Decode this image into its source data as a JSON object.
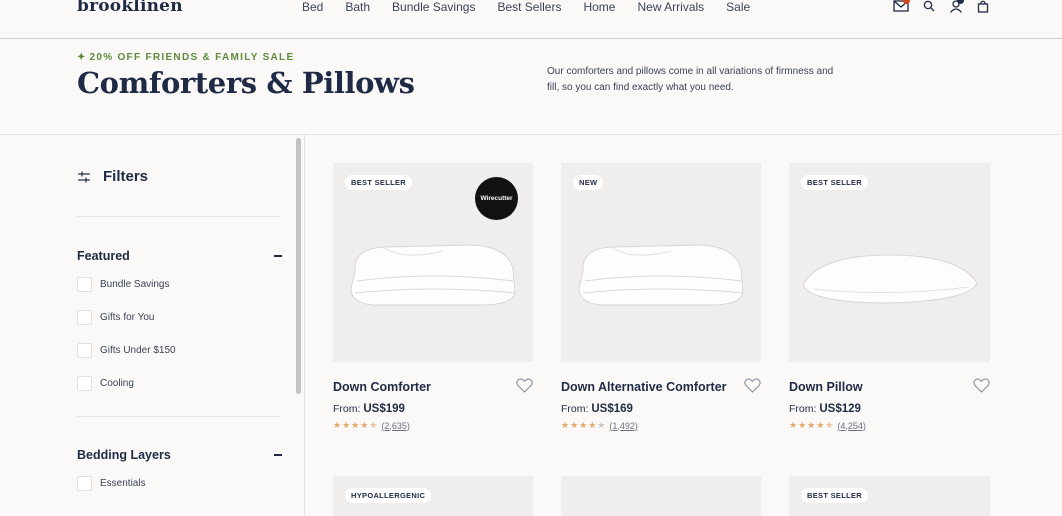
{
  "brand": "brooklinen",
  "nav": [
    "Bed",
    "Bath",
    "Bundle Savings",
    "Best Sellers",
    "Home",
    "New Arrivals",
    "Sale"
  ],
  "header_icons": [
    "mail-icon",
    "search-icon",
    "account-icon",
    "bag-icon"
  ],
  "hero": {
    "promo": "20% OFF FRIENDS & FAMILY SALE",
    "title": "Comforters & Pillows",
    "subtitle": "Our comforters and pillows come in all variations of firmness and fill, so you can find exactly what you need."
  },
  "filters": {
    "label": "Filters",
    "groups": [
      {
        "title": "Featured",
        "options": [
          "Bundle Savings",
          "Gifts for You",
          "Gifts Under $150",
          "Cooling"
        ]
      },
      {
        "title": "Bedding Layers",
        "options": [
          "Essentials"
        ]
      }
    ]
  },
  "products": [
    {
      "tag": "BEST SELLER",
      "name": "Down Comforter",
      "from": "From:",
      "price": "US$199",
      "rating": 4.5,
      "reviews": "(2,635)",
      "award": "Wirecutter"
    },
    {
      "tag": "NEW",
      "name": "Down Alternative Comforter",
      "from": "From:",
      "price": "US$169",
      "rating": 4,
      "reviews": "(1,492)"
    },
    {
      "tag": "BEST SELLER",
      "name": "Down Pillow",
      "from": "From:",
      "price": "US$129",
      "rating": 4.5,
      "reviews": "(4,254)"
    }
  ],
  "products_row2_tags": [
    "HYPOALLERGENIC",
    "",
    "BEST SELLER"
  ],
  "colors": {
    "navy": "#1f2a44",
    "promo_green": "#5d8a3c",
    "star": "#e2a86a",
    "badge": "#d04a1b"
  }
}
